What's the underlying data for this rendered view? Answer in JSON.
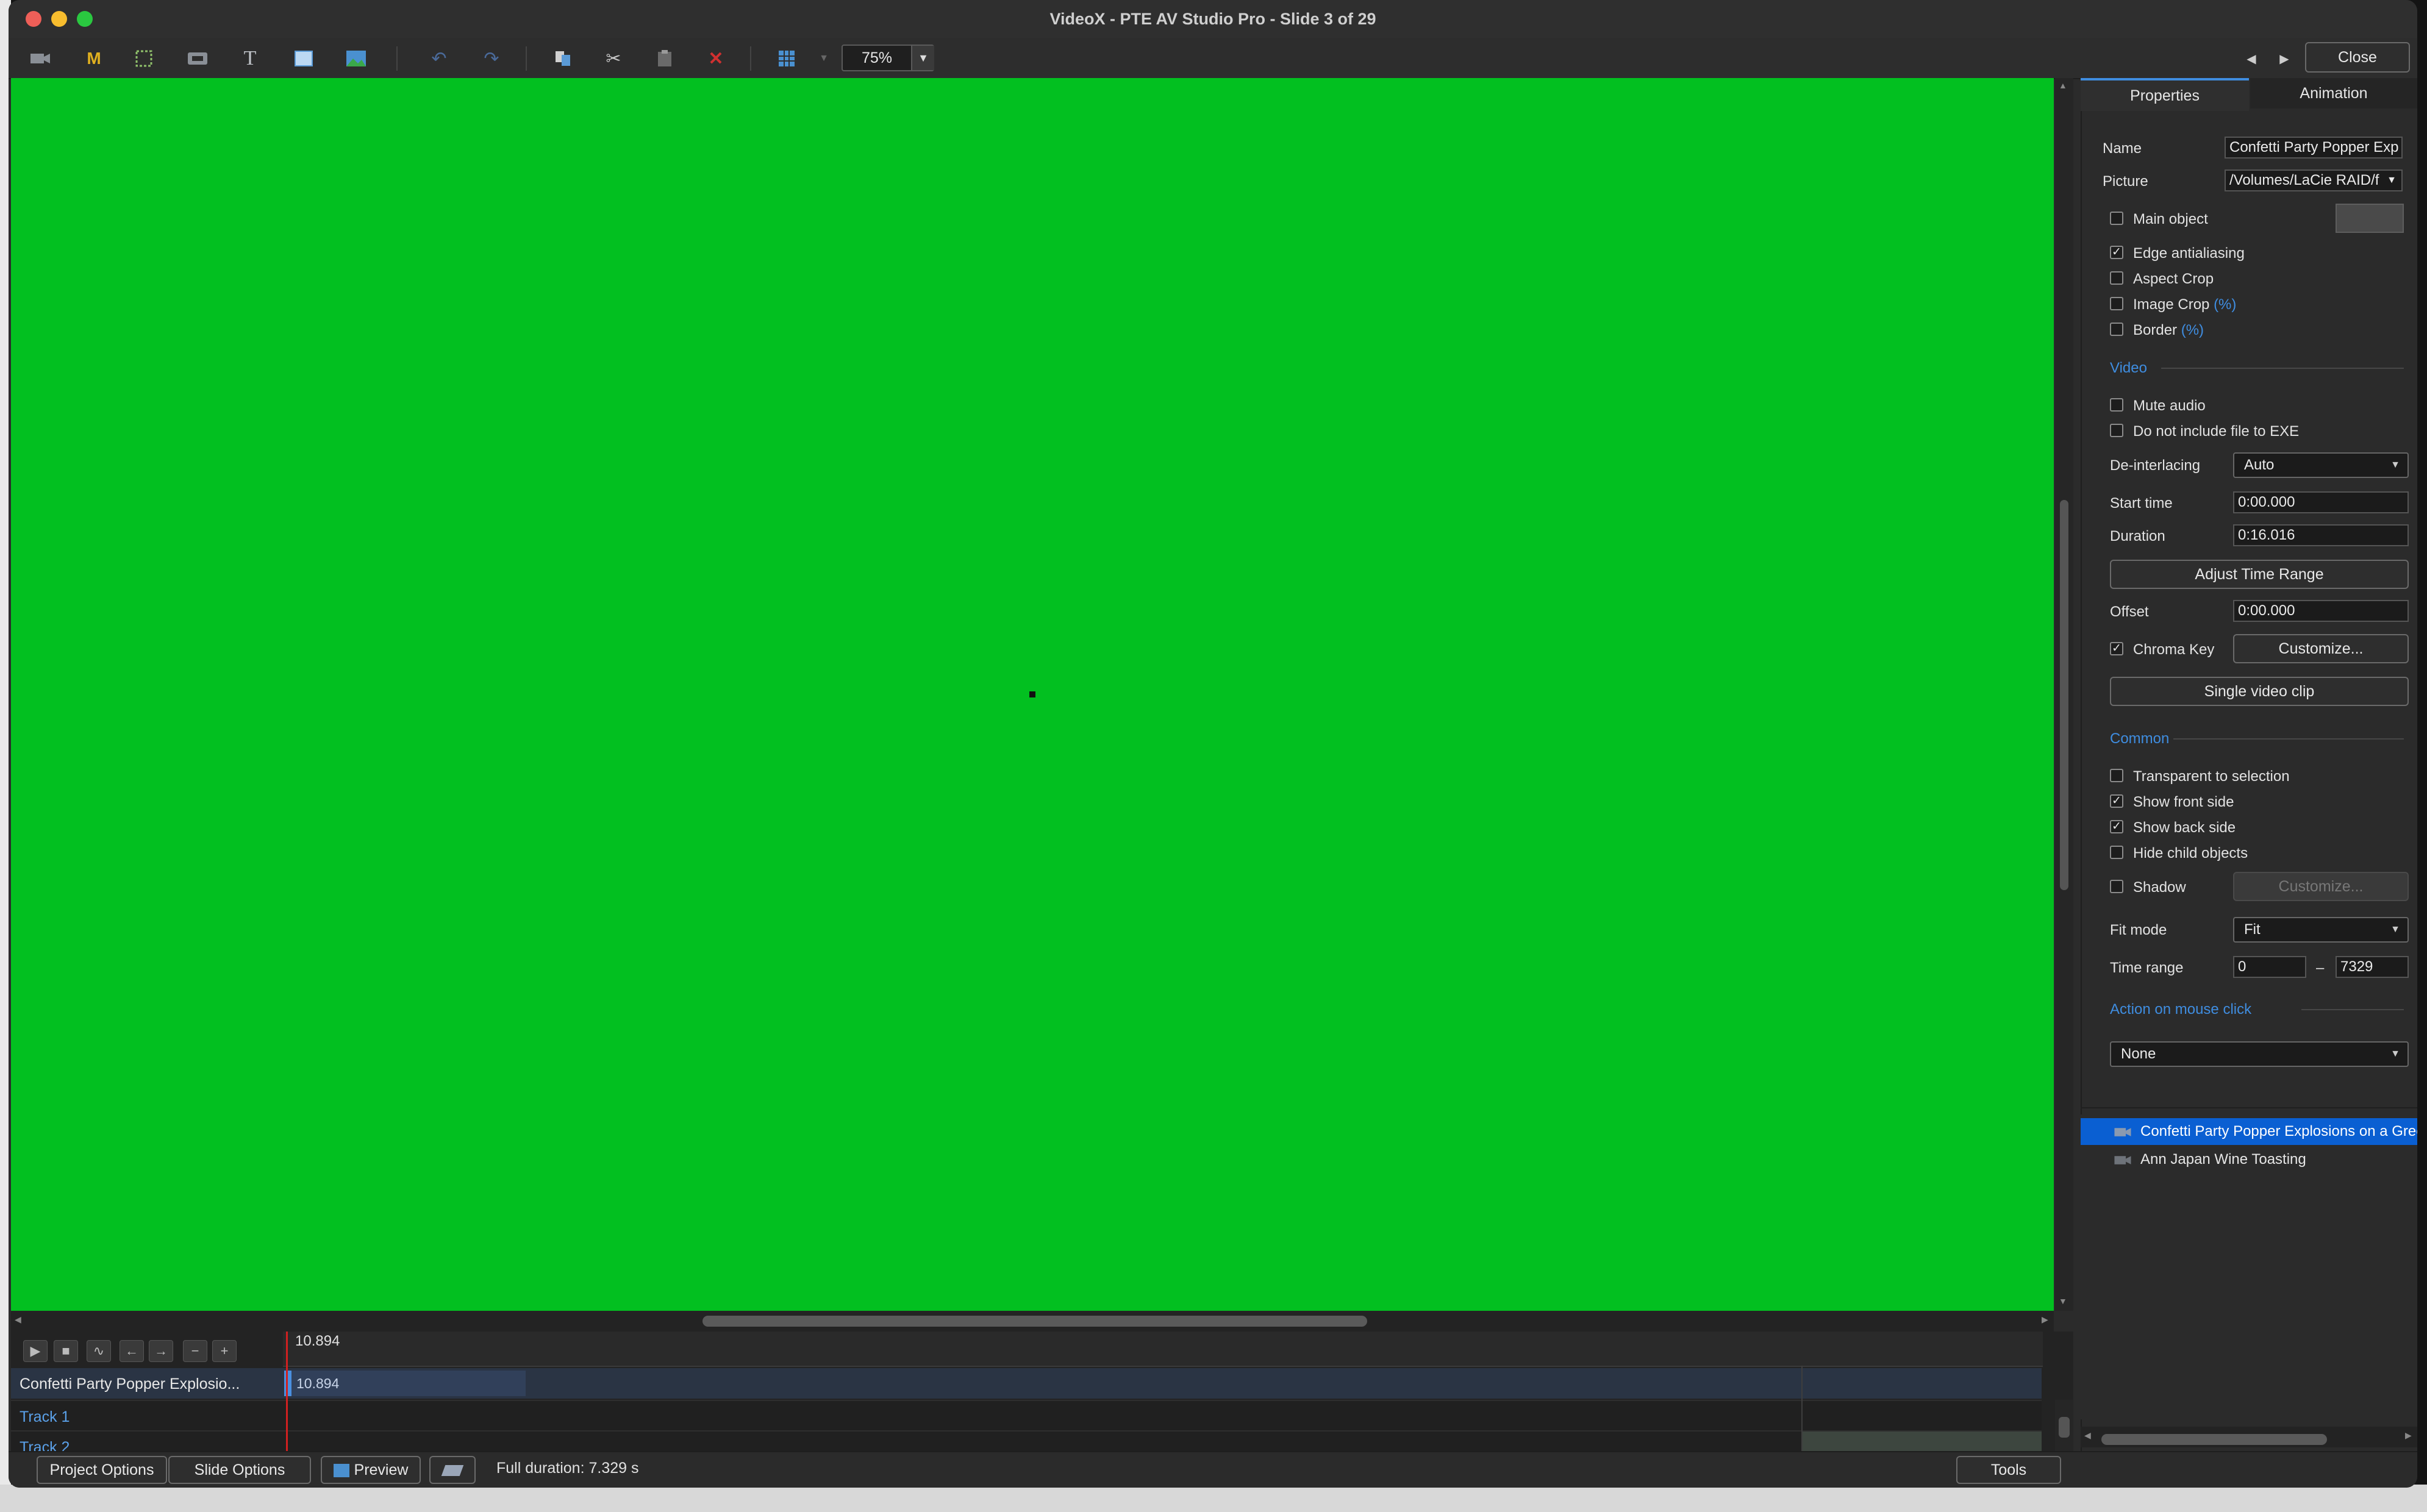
{
  "window": {
    "title": "VideoX - PTE AV Studio Pro - Slide 3 of 29",
    "close_label": "Close",
    "colors": {
      "canvas": "#02C020",
      "accent": "#3F8DE0",
      "selection": "#0A5FD2"
    }
  },
  "toolbar": {
    "zoom_value": "75%",
    "icons": [
      "video-object-icon",
      "mask-icon",
      "frame-icon",
      "button-icon",
      "text-icon",
      "rectangle-icon",
      "image-icon",
      "undo-icon",
      "redo-icon",
      "copy-icon",
      "cut-icon",
      "paste-icon",
      "delete-icon",
      "grid-icon"
    ]
  },
  "tabs": {
    "properties": "Properties",
    "animation": "Animation"
  },
  "properties": {
    "name_label": "Name",
    "name_value": "Confetti Party Popper Exp",
    "picture_label": "Picture",
    "picture_value": "/Volumes/LaCie RAID/f",
    "main_object": "Main object",
    "edge_antialiasing": "Edge antialiasing",
    "aspect_crop": "Aspect Crop",
    "image_crop": "Image Crop",
    "border": "Border",
    "percent": "(%)",
    "video_section": "Video",
    "mute_audio": "Mute audio",
    "do_not_include": "Do not include file to EXE",
    "deinterlacing_label": "De-interlacing",
    "deinterlacing_value": "Auto",
    "start_time_label": "Start time",
    "start_time_value": "0:00.000",
    "duration_label": "Duration",
    "duration_value": "0:16.016",
    "adjust_time_range": "Adjust Time Range",
    "offset_label": "Offset",
    "offset_value": "0:00.000",
    "chroma_key": "Chroma Key",
    "customize": "Customize...",
    "single_video_clip": "Single video clip",
    "common_section": "Common",
    "transparent_to_selection": "Transparent to selection",
    "show_front_side": "Show front side",
    "show_back_side": "Show back side",
    "hide_child_objects": "Hide child objects",
    "shadow": "Shadow",
    "shadow_customize": "Customize...",
    "fit_mode_label": "Fit mode",
    "fit_mode_value": "Fit",
    "time_range_label": "Time range",
    "time_range_from": "0",
    "time_range_dash": "–",
    "time_range_to": "7329",
    "action_section": "Action on mouse click",
    "action_value": "None"
  },
  "checkboxes": {
    "main_object": false,
    "edge_antialiasing": true,
    "aspect_crop": false,
    "image_crop": false,
    "border": false,
    "mute_audio": false,
    "do_not_include": false,
    "chroma_key": true,
    "transparent_to_selection": false,
    "show_front_side": true,
    "show_back_side": true,
    "hide_child_objects": false,
    "shadow": false
  },
  "objects": [
    {
      "label": "Confetti Party Popper Explosions on a Gree",
      "selected": true
    },
    {
      "label": "Ann Japan Wine Toasting",
      "selected": false
    }
  ],
  "timeline": {
    "current_time": "10.894",
    "clip_time": "10.894",
    "rows": [
      "Confetti Party Popper Explosio...",
      "Track 1",
      "Track 2"
    ]
  },
  "bottombar": {
    "project_options": "Project Options",
    "slide_options": "Slide Options",
    "preview": "Preview",
    "full_duration": "Full duration: 7.329 s",
    "tools": "Tools"
  }
}
